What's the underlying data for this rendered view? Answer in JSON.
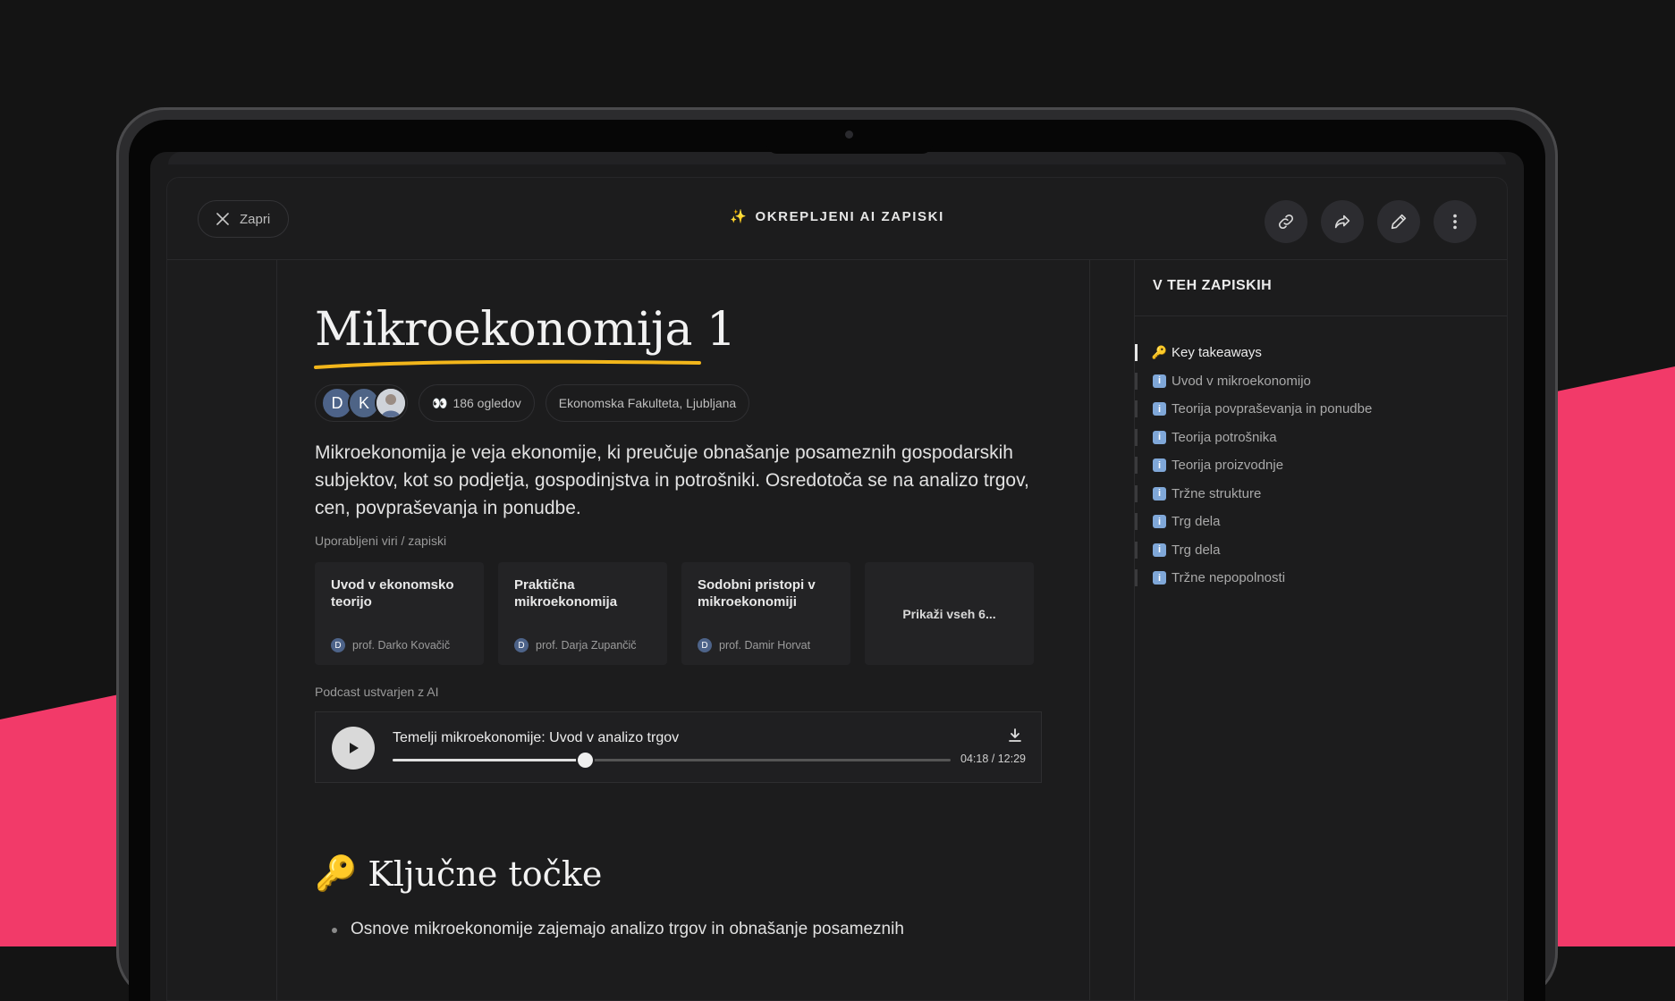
{
  "header": {
    "close_label": "Zapri",
    "title": "OKREPLJENI AI ZAPISKI",
    "actions": [
      "link-icon",
      "share-icon",
      "edit-icon",
      "more-icon"
    ]
  },
  "doc": {
    "title": "Mikroekonomija 1",
    "avatars": [
      "D",
      "K"
    ],
    "views": "186 ogledov",
    "institution": "Ekonomska Fakulteta, Ljubljana",
    "description": "Mikroekonomija je veja ekonomije, ki preučuje obnašanje posameznih gospodarskih subjektov, kot so podjetja, gospodinjstva in potrošniki. Osredotoča se na analizo trgov, cen, povpraševanja in ponudbe."
  },
  "sources": {
    "label": "Uporabljeni viri / zapiski",
    "items": [
      {
        "title": "Uvod v ekonomsko teorijo",
        "author_initial": "D",
        "author": "prof. Darko Kovačič"
      },
      {
        "title": "Praktična mikroekonomija",
        "author_initial": "D",
        "author": "prof. Darja Zupančič"
      },
      {
        "title": "Sodobni pristopi v mikroekonomiji",
        "author_initial": "D",
        "author": "prof. Damir Horvat"
      }
    ],
    "show_all": "Prikaži vseh 6..."
  },
  "podcast": {
    "label": "Podcast ustvarjen z AI",
    "title": "Temelji mikroekonomije: Uvod v analizo trgov",
    "time": "04:18 / 12:29",
    "progress": 0.344
  },
  "key_points": {
    "heading": "Ključne točke",
    "first_bullet": "Osnove mikroekonomije zajemajo analizo trgov in obnašanje posameznih"
  },
  "sidebar": {
    "title": "V TEH ZAPISKIH",
    "items": [
      {
        "label": "Key takeaways",
        "icon": "🔑",
        "active": true
      },
      {
        "label": "Uvod v mikroekonomijo",
        "icon": "i"
      },
      {
        "label": "Teorija povpraševanja in ponudbe",
        "icon": "i"
      },
      {
        "label": "Teorija potrošnika",
        "icon": "i"
      },
      {
        "label": "Teorija proizvodnje",
        "icon": "i"
      },
      {
        "label": "Tržne strukture",
        "icon": "i"
      },
      {
        "label": "Trg dela",
        "icon": "i"
      },
      {
        "label": "Trg dela",
        "icon": "i"
      },
      {
        "label": "Tržne nepopolnosti",
        "icon": "i"
      }
    ]
  },
  "colors": {
    "accent_pink": "#f23a69",
    "underline_yellow": "#f2b61b",
    "background": "#1c1c1d"
  }
}
